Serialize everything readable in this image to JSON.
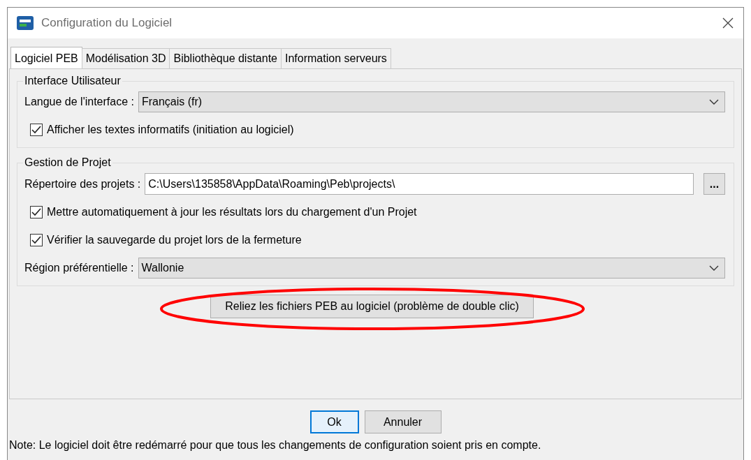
{
  "window": {
    "title": "Configuration du Logiciel"
  },
  "tabs": [
    {
      "label": "Logiciel PEB",
      "selected": true
    },
    {
      "label": "Modélisation 3D",
      "selected": false
    },
    {
      "label": "Bibliothèque distante",
      "selected": false
    },
    {
      "label": "Information serveurs",
      "selected": false
    }
  ],
  "groups": [
    {
      "title": "Interface Utilisateur",
      "rows": [
        {
          "kind": "select",
          "label": "Langue de l'interface :",
          "value": "Français (fr)"
        },
        {
          "kind": "checkbox",
          "label": "Afficher les textes informatifs (initiation au logiciel)",
          "checked": true
        }
      ]
    },
    {
      "title": "Gestion de Projet",
      "rows": [
        {
          "kind": "path",
          "label": "Répertoire des projets :",
          "value": "C:\\Users\\135858\\AppData\\Roaming\\Peb\\projects\\",
          "button": "..."
        },
        {
          "kind": "checkbox",
          "label": "Mettre automatiquement à jour les résultats lors du chargement d'un Projet",
          "checked": true
        },
        {
          "kind": "checkbox",
          "label": "Vérifier la sauvegarde du projet lors de la fermeture",
          "checked": true
        },
        {
          "kind": "select",
          "label": "Région préférentielle :",
          "value": "Wallonie"
        }
      ]
    }
  ],
  "action_button": {
    "label": "Reliez les fichiers PEB au logiciel (problème de double clic)",
    "highlighted": true
  },
  "buttons": [
    {
      "label": "Ok",
      "default": true
    },
    {
      "label": "Annuler",
      "default": false
    }
  ],
  "note": "Note: Le logiciel doit être redémarré pour que tous les changements de configuration soient pris en compte."
}
